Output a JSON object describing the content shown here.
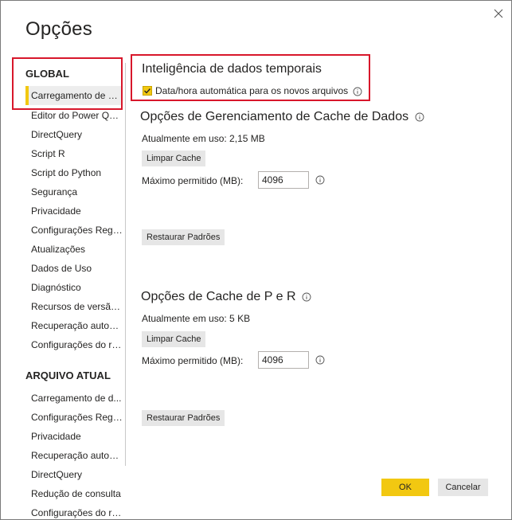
{
  "dialog": {
    "title": "Opções"
  },
  "sidebar": {
    "global_header": "GLOBAL",
    "global_items": [
      {
        "label": "Carregamento de Dados",
        "selected": true
      },
      {
        "label": "Editor do Power Query"
      },
      {
        "label": "DirectQuery"
      },
      {
        "label": "Script R"
      },
      {
        "label": "Script do Python"
      },
      {
        "label": "Segurança"
      },
      {
        "label": "Privacidade"
      },
      {
        "label": "Configurações Regi..."
      },
      {
        "label": "Atualizações"
      },
      {
        "label": "Dados de Uso"
      },
      {
        "label": "Diagnóstico"
      },
      {
        "label": "Recursos de versão..."
      },
      {
        "label": "Recuperação autom..."
      },
      {
        "label": "Configurações do re..."
      }
    ],
    "file_header": "ARQUIVO ATUAL",
    "file_items": [
      {
        "label": "Carregamento de d..."
      },
      {
        "label": "Configurações Regi..."
      },
      {
        "label": "Privacidade"
      },
      {
        "label": "Recuperação autom..."
      },
      {
        "label": "DirectQuery"
      },
      {
        "label": "Redução de consulta"
      },
      {
        "label": "Configurações do re..."
      }
    ]
  },
  "time_intelligence": {
    "heading": "Inteligência de dados temporais",
    "checkbox_label": "Data/hora automática para os novos arquivos",
    "checked": true
  },
  "data_cache": {
    "heading": "Opções de Gerenciamento de Cache de Dados",
    "in_use": "Atualmente em uso: 2,15 MB",
    "clear_label": "Limpar Cache",
    "max_label": "Máximo permitido (MB):",
    "max_value": "4096",
    "restore_label": "Restaurar Padrões"
  },
  "qa_cache": {
    "heading": "Opções de Cache de P e R",
    "in_use": "Atualmente em uso: 5 KB",
    "clear_label": "Limpar Cache",
    "max_label": "Máximo permitido (MB):",
    "max_value": "4096",
    "restore_label": "Restaurar Padrões"
  },
  "footer": {
    "ok_label": "OK",
    "cancel_label": "Cancelar"
  },
  "colors": {
    "accent": "#f2c811",
    "highlight": "#d8172b",
    "button_bg": "#e6e6e6"
  }
}
